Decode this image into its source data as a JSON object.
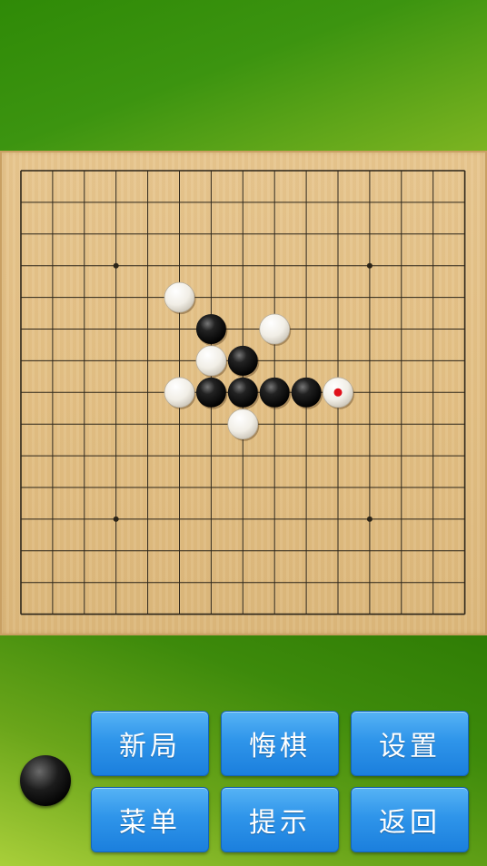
{
  "colors": {
    "board": "#e3c085",
    "grid_line": "#2b2418",
    "black_stone": "#111111",
    "white_stone": "#f4f1ea",
    "last_move_marker": "#e0101a",
    "button": "#2f95ea"
  },
  "board": {
    "size": 15,
    "star_points": [
      [
        3,
        3
      ],
      [
        11,
        3
      ],
      [
        3,
        11
      ],
      [
        11,
        11
      ]
    ],
    "stones": [
      {
        "col": 5,
        "row": 4,
        "color": "white"
      },
      {
        "col": 6,
        "row": 5,
        "color": "black"
      },
      {
        "col": 8,
        "row": 5,
        "color": "white"
      },
      {
        "col": 6,
        "row": 6,
        "color": "white"
      },
      {
        "col": 7,
        "row": 6,
        "color": "black"
      },
      {
        "col": 5,
        "row": 7,
        "color": "white"
      },
      {
        "col": 6,
        "row": 7,
        "color": "black"
      },
      {
        "col": 7,
        "row": 7,
        "color": "black"
      },
      {
        "col": 8,
        "row": 7,
        "color": "black"
      },
      {
        "col": 9,
        "row": 7,
        "color": "black"
      },
      {
        "col": 10,
        "row": 7,
        "color": "white",
        "last_move": true
      },
      {
        "col": 7,
        "row": 8,
        "color": "white"
      }
    ]
  },
  "current_turn": "black",
  "buttons": {
    "new_game": "新局",
    "undo": "悔棋",
    "settings": "设置",
    "menu": "菜单",
    "hint": "提示",
    "back": "返回"
  }
}
